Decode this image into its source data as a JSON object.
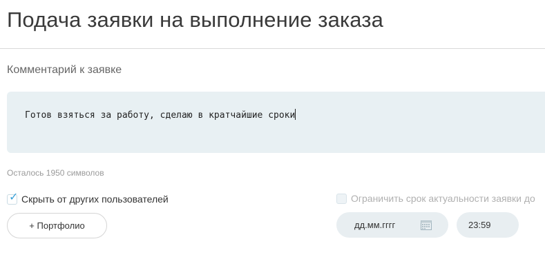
{
  "page": {
    "title": "Подача заявки на выполнение заказа"
  },
  "comment": {
    "label": "Комментарий к заявке",
    "text": "Готов взяться за работу, сделаю в кратчайшие сроки",
    "remaining": "Осталось 1950 символов"
  },
  "options": {
    "hide_label": "Скрыть от других пользователей",
    "hide_checked": true,
    "limit_label": "Ограничить срок актуальности заявки до",
    "limit_checked": false
  },
  "actions": {
    "portfolio_label": "+ Портфолио"
  },
  "deadline": {
    "date_placeholder": "дд.мм.гггг",
    "time_value": "23:59"
  },
  "colors": {
    "accent": "#3ba1d8",
    "comment_bg": "#e8f0f3",
    "pill_bg": "#e8eef1"
  },
  "icons": {
    "checkbox": "checkmark-icon",
    "date": "calendar-icon"
  }
}
